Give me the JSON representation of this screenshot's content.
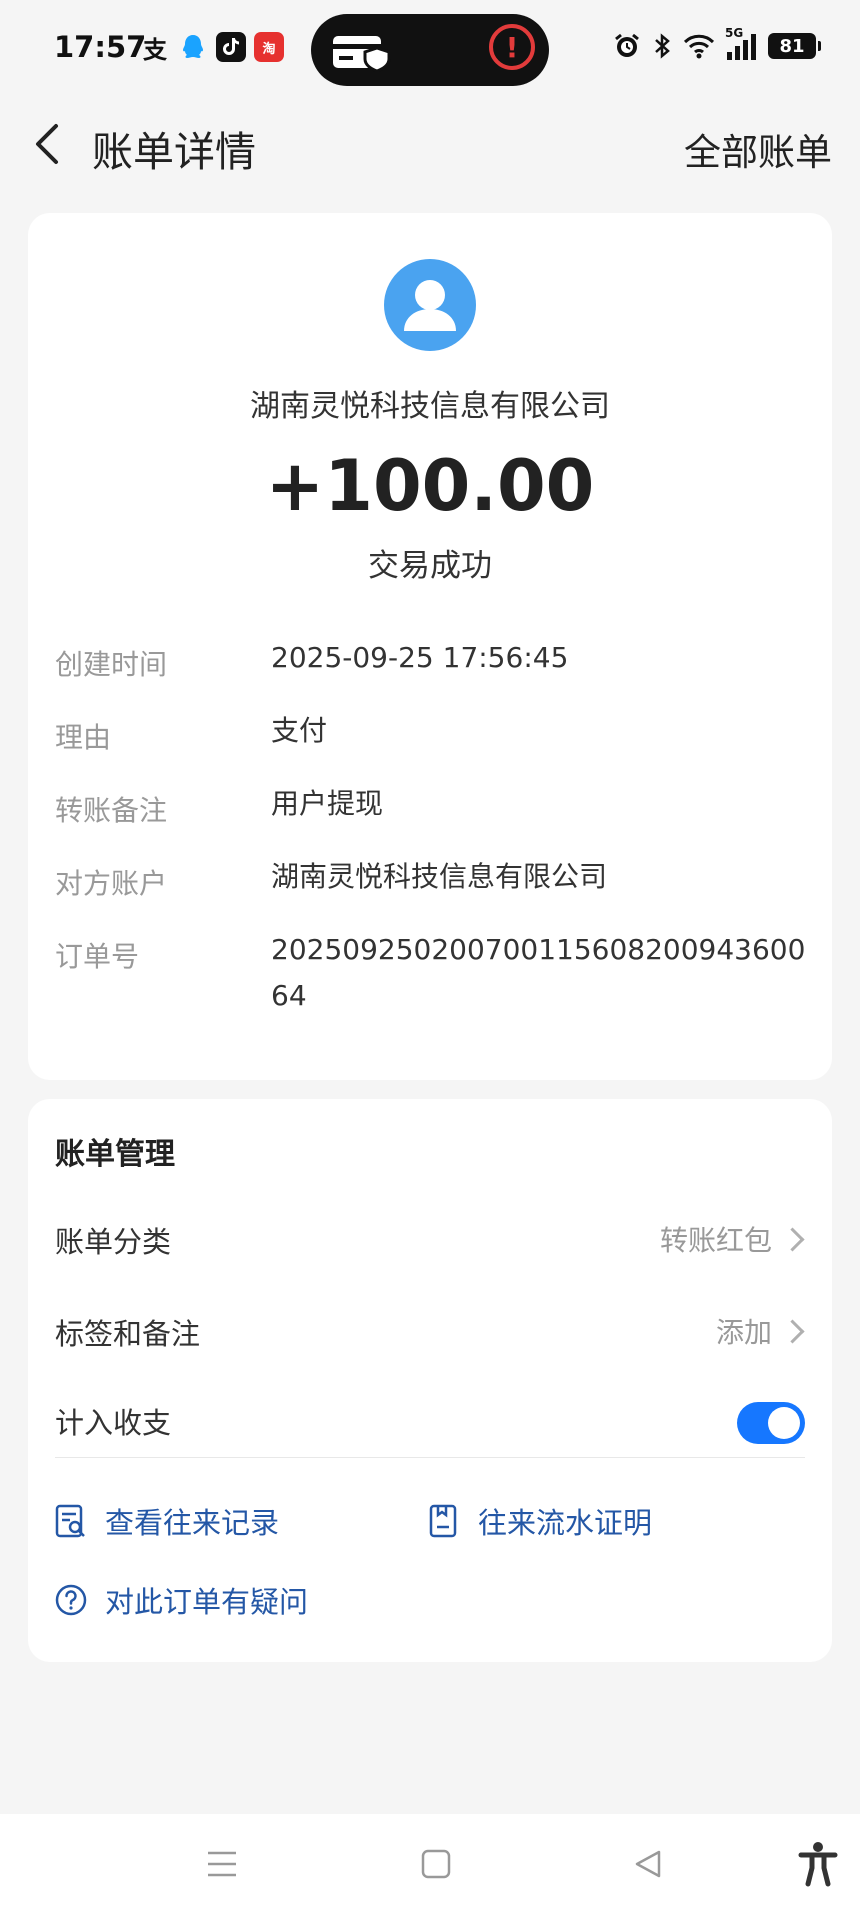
{
  "status_bar": {
    "time": "17:57",
    "battery": "81",
    "network": "5G",
    "app_icons": [
      "alipay-icon",
      "qq-icon",
      "tiktok-icon",
      "taobao-icon"
    ]
  },
  "header": {
    "title": "账单详情",
    "right_link": "全部账单"
  },
  "summary": {
    "counterparty": "湖南灵悦科技信息有限公司",
    "amount": "+100.00",
    "status": "交易成功"
  },
  "details": [
    {
      "label": "创建时间",
      "value": "2025-09-25 17:56:45"
    },
    {
      "label": "理由",
      "value": "支付"
    },
    {
      "label": "转账备注",
      "value": "用户提现"
    },
    {
      "label": "对方账户",
      "value": "湖南灵悦科技信息有限公司"
    },
    {
      "label": "订单号",
      "value": "20250925020070011560820094360064"
    }
  ],
  "manage": {
    "title": "账单管理",
    "category_label": "账单分类",
    "category_value": "转账红包",
    "tags_label": "标签和备注",
    "tags_value": "添加",
    "include_label": "计入收支",
    "include_enabled": true
  },
  "links": {
    "records": "查看往来记录",
    "proof": "往来流水证明",
    "question": "对此订单有疑问"
  },
  "colors": {
    "accent": "#1677ff",
    "link": "#2457a6",
    "avatar": "#4aa3f0",
    "background": "#f5f5f5"
  }
}
